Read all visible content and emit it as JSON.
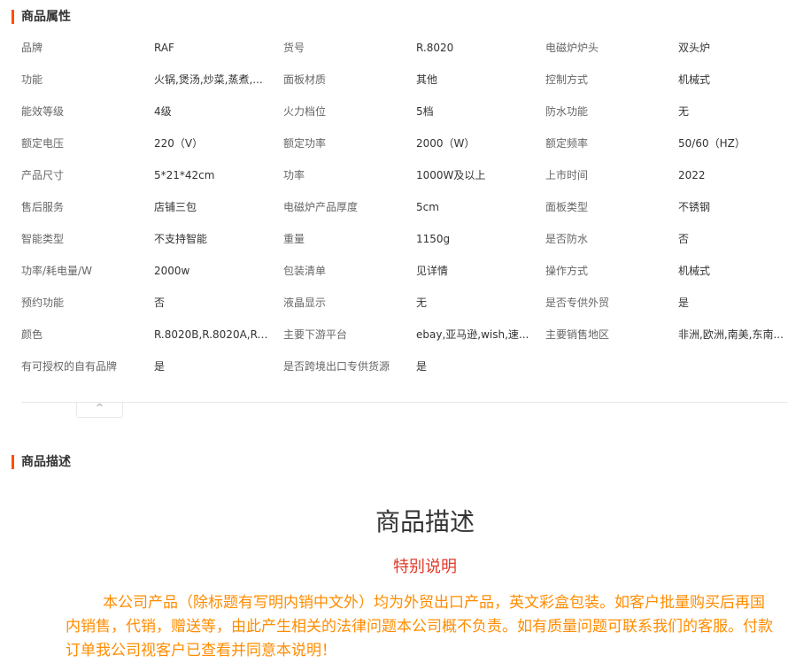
{
  "attributes_title": "商品属性",
  "attributes": [
    [
      {
        "label": "品牌",
        "value": "RAF"
      },
      {
        "label": "货号",
        "value": "R.8020"
      },
      {
        "label": "电磁炉炉头",
        "value": "双头炉"
      }
    ],
    [
      {
        "label": "功能",
        "value": "火锅,煲汤,炒菜,蒸煮,..."
      },
      {
        "label": "面板材质",
        "value": "其他"
      },
      {
        "label": "控制方式",
        "value": "机械式"
      }
    ],
    [
      {
        "label": "能效等级",
        "value": "4级"
      },
      {
        "label": "火力档位",
        "value": "5档"
      },
      {
        "label": "防水功能",
        "value": "无"
      }
    ],
    [
      {
        "label": "额定电压",
        "value": "220（V）"
      },
      {
        "label": "额定功率",
        "value": "2000（W）"
      },
      {
        "label": "额定频率",
        "value": "50/60（HZ）"
      }
    ],
    [
      {
        "label": "产品尺寸",
        "value": "5*21*42cm"
      },
      {
        "label": "功率",
        "value": "1000W及以上"
      },
      {
        "label": "上市时间",
        "value": "2022"
      }
    ],
    [
      {
        "label": "售后服务",
        "value": "店铺三包"
      },
      {
        "label": "电磁炉产品厚度",
        "value": "5cm"
      },
      {
        "label": "面板类型",
        "value": "不锈钢"
      }
    ],
    [
      {
        "label": "智能类型",
        "value": "不支持智能"
      },
      {
        "label": "重量",
        "value": "1150g"
      },
      {
        "label": "是否防水",
        "value": "否"
      }
    ],
    [
      {
        "label": "功率/耗电量/W",
        "value": "2000w"
      },
      {
        "label": "包装清单",
        "value": "见详情"
      },
      {
        "label": "操作方式",
        "value": "机械式"
      }
    ],
    [
      {
        "label": "预约功能",
        "value": "否"
      },
      {
        "label": "液晶显示",
        "value": "无"
      },
      {
        "label": "是否专供外贸",
        "value": "是"
      }
    ],
    [
      {
        "label": "颜色",
        "value": "R.8020B,R.8020A,R.9..."
      },
      {
        "label": "主要下游平台",
        "value": "ebay,亚马逊,wish,速..."
      },
      {
        "label": "主要销售地区",
        "value": "非洲,欧洲,南美,东南..."
      }
    ],
    [
      {
        "label": "有可授权的自有品牌",
        "value": "是"
      },
      {
        "label": "是否跨境出口专供货源",
        "value": "是"
      }
    ]
  ],
  "collapse_icon": "chevron-up-icon",
  "collapse_glyph": "^",
  "description_title": "商品描述",
  "description": {
    "heading": "商品描述",
    "subheading": "特别说明",
    "notice": "本公司产品（除标题有写明内销中文外）均为外贸出口产品，英文彩盒包装。如客户批量购买后再国内销售，代销，赠送等，由此产生相关的法律问题本公司概不负责。如有质量问题可联系我们的客服。付款订单我公司视客户已查看并同意本说明！"
  },
  "colors": {
    "accent": "#ff5000",
    "subheading": "#e23a2a",
    "notice": "#ff8c00"
  }
}
